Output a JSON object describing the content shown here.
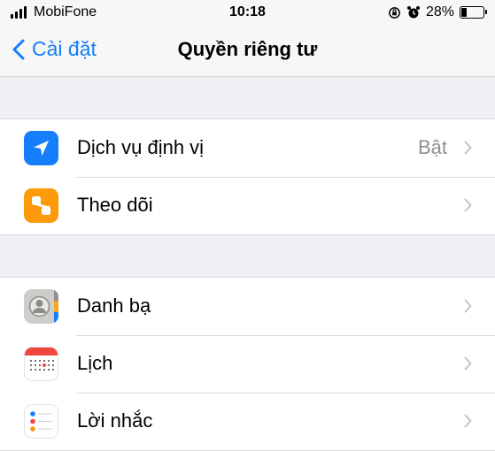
{
  "status_bar": {
    "carrier": "MobiFone",
    "time": "10:18",
    "battery_percent": "28%",
    "battery_level": 0.28
  },
  "nav": {
    "back_label": "Cài đặt",
    "title": "Quyền riêng tư"
  },
  "groups": [
    {
      "items": [
        {
          "label": "Dịch vụ định vị",
          "value": "Bật",
          "icon": "location-arrow-icon",
          "color": "#147efb"
        },
        {
          "label": "Theo dõi",
          "value": "",
          "icon": "tracking-icon",
          "color": "#fd9a0a"
        }
      ]
    },
    {
      "items": [
        {
          "label": "Danh bạ",
          "value": "",
          "icon": "contacts-icon",
          "color": "#cfcdc9"
        },
        {
          "label": "Lịch",
          "value": "",
          "icon": "calendar-icon",
          "color": "#ffffff"
        },
        {
          "label": "Lời nhắc",
          "value": "",
          "icon": "reminders-icon",
          "color": "#ffffff"
        }
      ]
    }
  ]
}
